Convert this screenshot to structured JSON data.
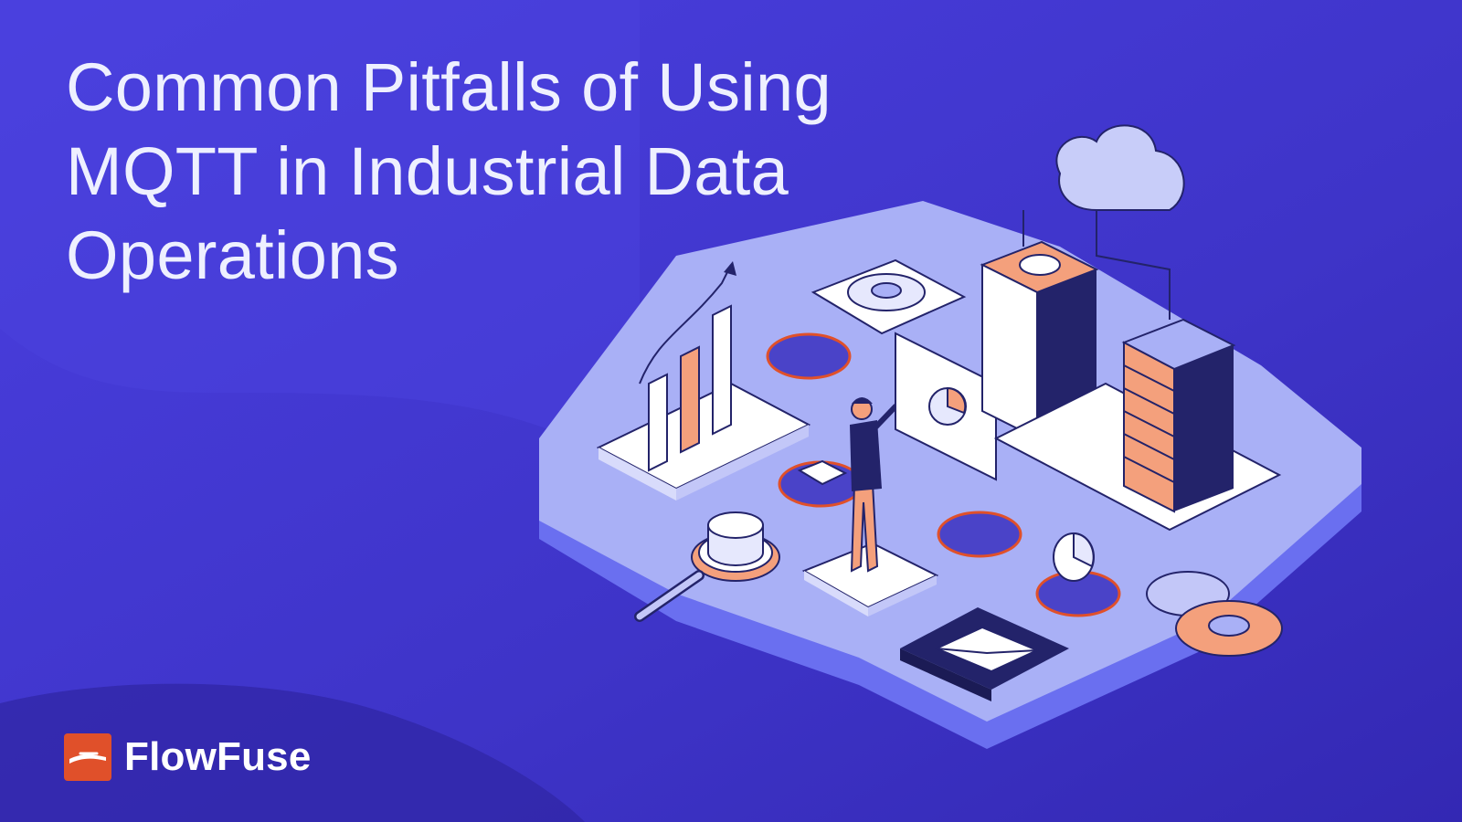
{
  "title": {
    "lines": [
      "Common Pitfalls of Using",
      "MQTT in Industrial Data",
      "Operations"
    ]
  },
  "brand": {
    "name": "FlowFuse",
    "logo_icon": "flowfuse-logo-icon"
  },
  "colors": {
    "background": "#3e33c6",
    "accent": "#e0502a",
    "platform": "#a9b0f6",
    "highlight": "#f4a07c",
    "outline": "#23236a"
  }
}
